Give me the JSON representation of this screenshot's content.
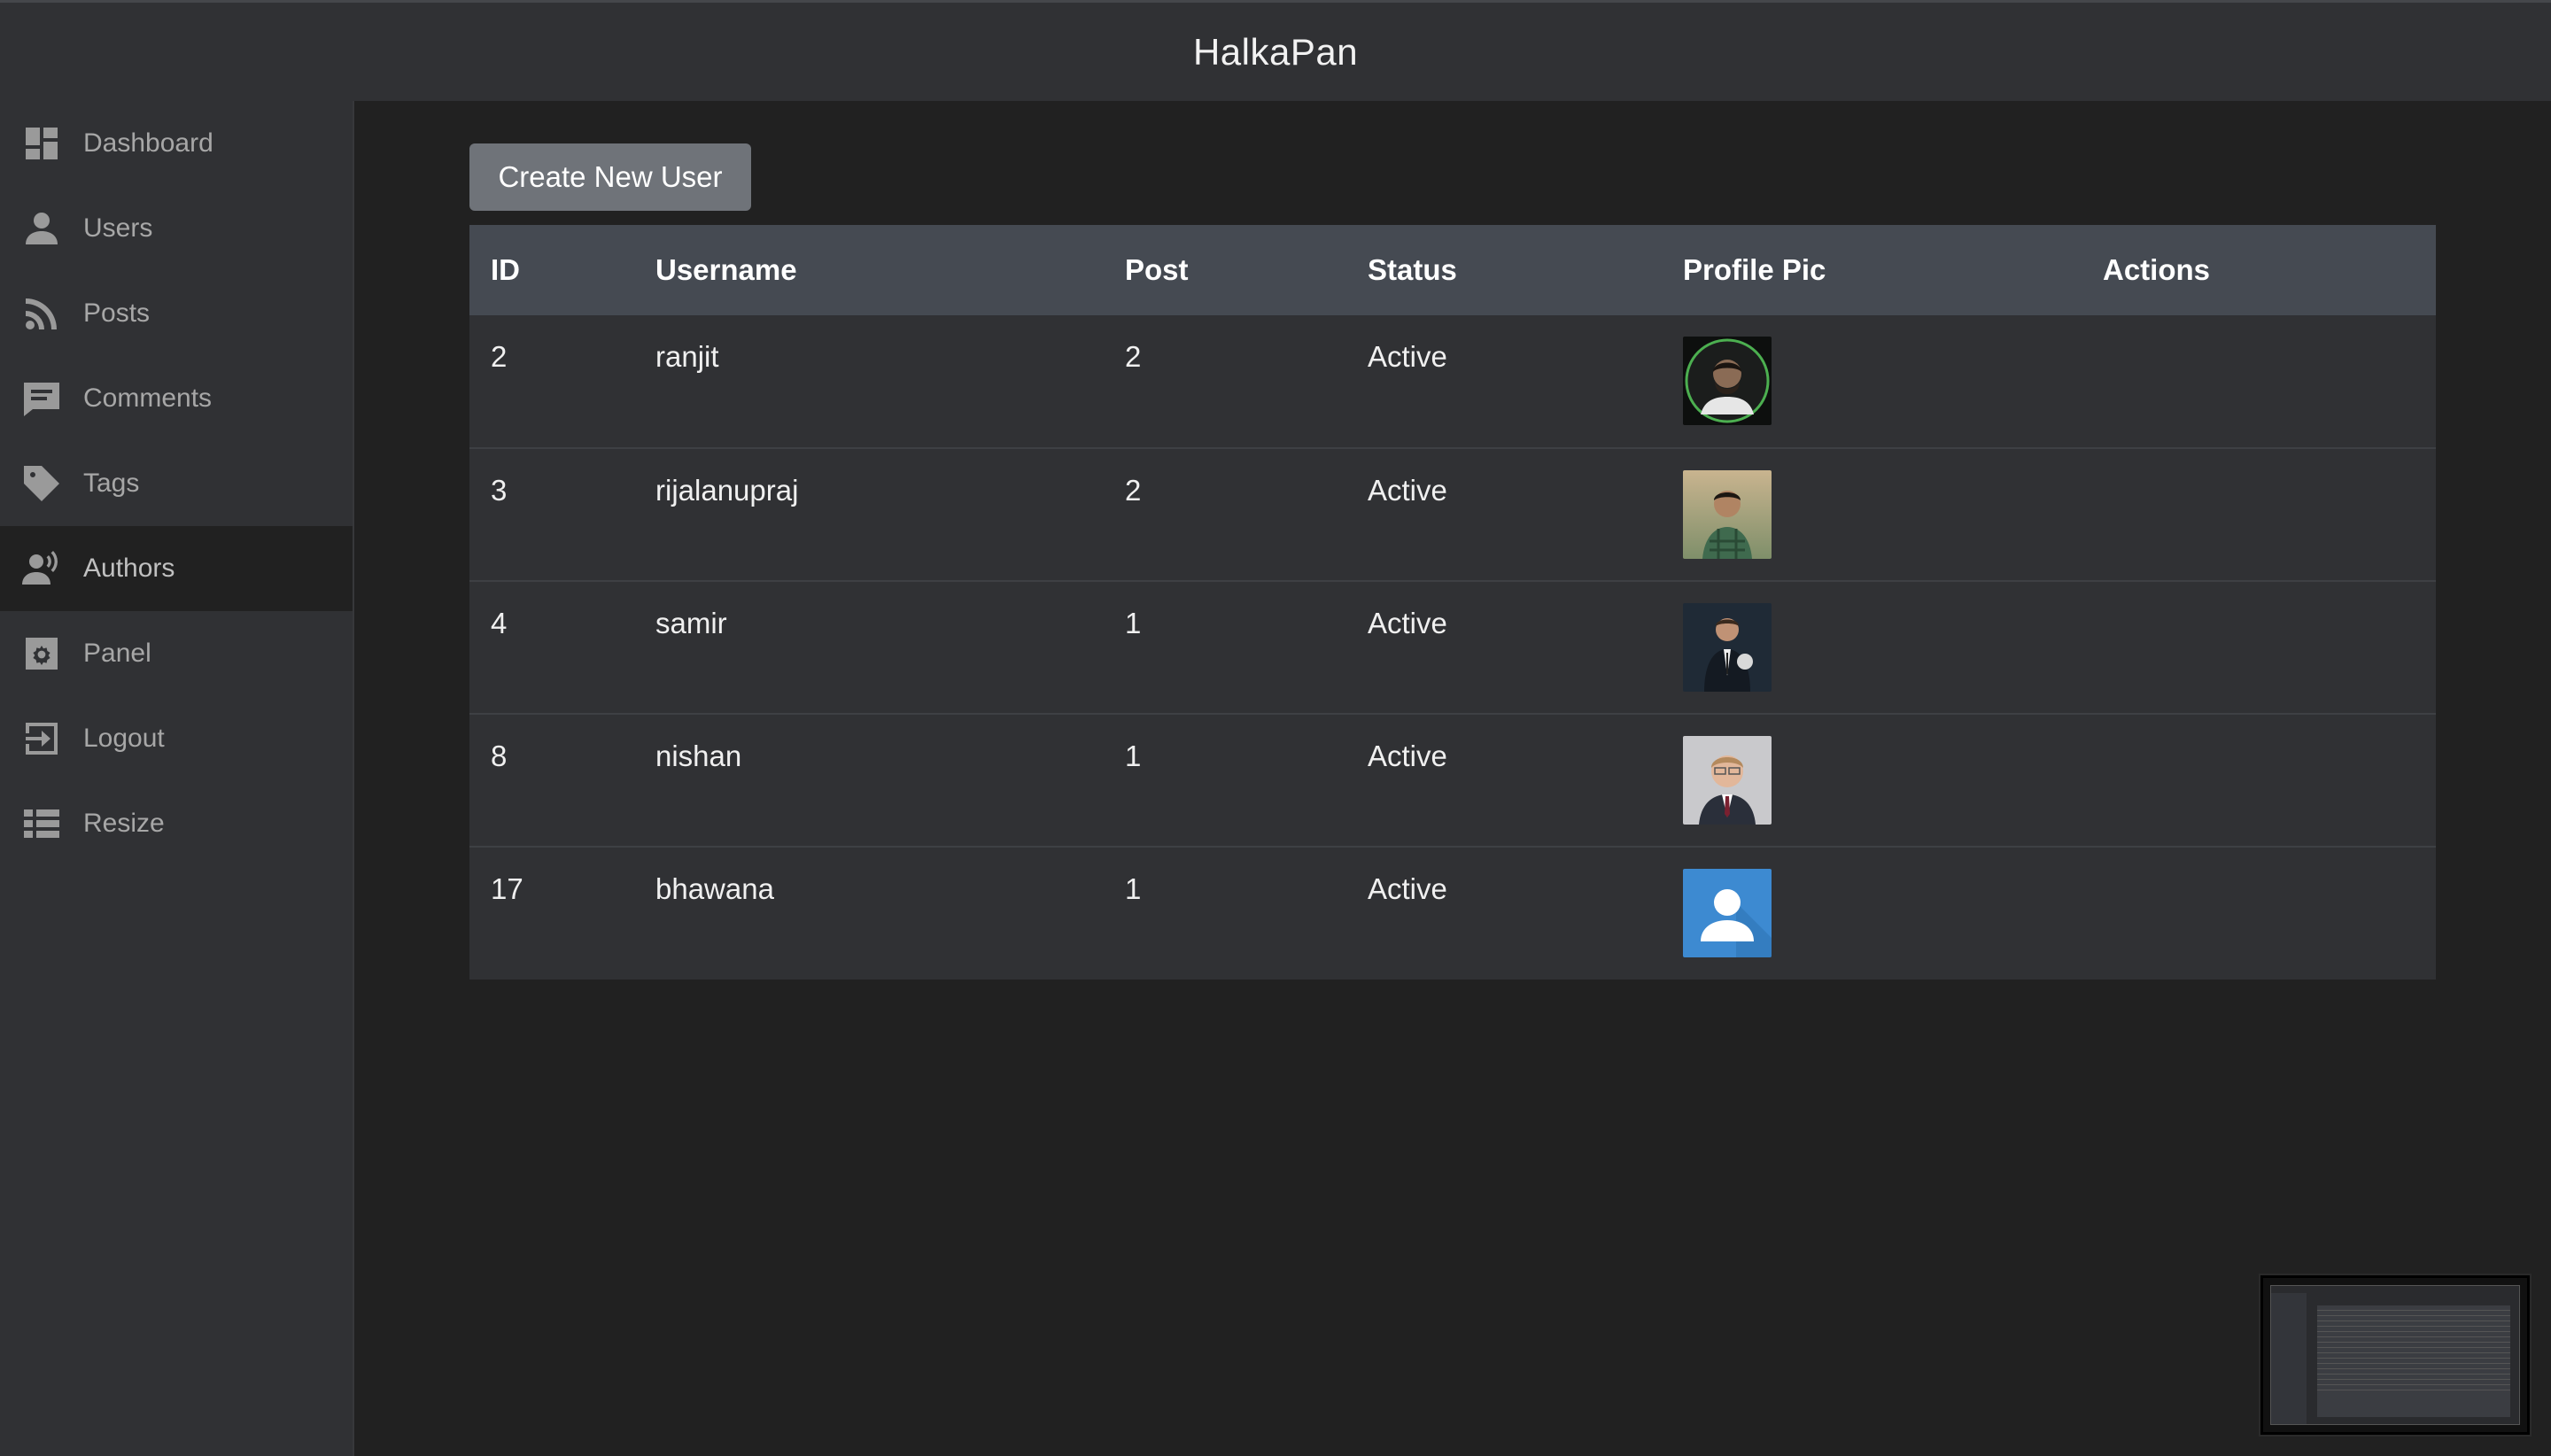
{
  "app": {
    "title": "HalkaPan"
  },
  "sidebar": {
    "items": [
      {
        "label": "Dashboard",
        "icon": "dashboard-icon",
        "active": false
      },
      {
        "label": "Users",
        "icon": "user-icon",
        "active": false
      },
      {
        "label": "Posts",
        "icon": "rss-icon",
        "active": false
      },
      {
        "label": "Comments",
        "icon": "comment-icon",
        "active": false
      },
      {
        "label": "Tags",
        "icon": "tag-icon",
        "active": false
      },
      {
        "label": "Authors",
        "icon": "speaker-user-icon",
        "active": true
      },
      {
        "label": "Panel",
        "icon": "gear-icon",
        "active": false
      },
      {
        "label": "Logout",
        "icon": "logout-icon",
        "active": false
      },
      {
        "label": "Resize",
        "icon": "list-icon",
        "active": false
      }
    ]
  },
  "main": {
    "create_button_label": "Create New User",
    "table": {
      "headers": [
        "ID",
        "Username",
        "Post",
        "Status",
        "Profile Pic",
        "Actions"
      ],
      "rows": [
        {
          "id": "2",
          "username": "ranjit",
          "post": "2",
          "status": "Active",
          "pic": "avatar-photo-ranjit"
        },
        {
          "id": "3",
          "username": "rijalanupraj",
          "post": "2",
          "status": "Active",
          "pic": "avatar-photo-rijalanupraj"
        },
        {
          "id": "4",
          "username": "samir",
          "post": "1",
          "status": "Active",
          "pic": "avatar-photo-samir"
        },
        {
          "id": "8",
          "username": "nishan",
          "post": "1",
          "status": "Active",
          "pic": "avatar-photo-nishan"
        },
        {
          "id": "17",
          "username": "bhawana",
          "post": "1",
          "status": "Active",
          "pic": "default-avatar-icon"
        }
      ]
    }
  },
  "colors": {
    "page_bg": "#212121",
    "sidebar_bg": "#303134",
    "header_row_bg": "#454a52",
    "button_bg": "#6f7379",
    "default_avatar_bg": "#3d8ad1"
  }
}
